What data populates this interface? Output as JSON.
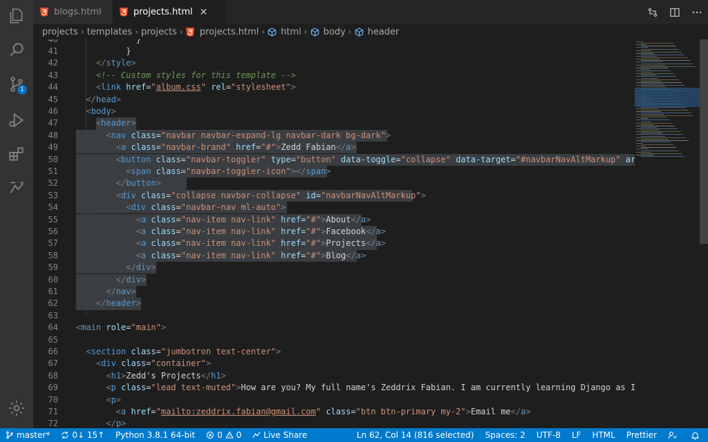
{
  "tabs": [
    {
      "label": "blogs.html"
    },
    {
      "label": "projects.html"
    }
  ],
  "breadcrumb": [
    "projects",
    "templates",
    "projects",
    "projects.html",
    "html",
    "body",
    "header"
  ],
  "editor": {
    "lines": [
      {
        "n": "40",
        "html": "            <span class=\"tx\">}</span>"
      },
      {
        "n": "41",
        "html": "          <span class=\"tx\">}</span>"
      },
      {
        "n": "42",
        "html": "    <span class=\"t\">&lt;/</span><span class=\"tn\">style</span><span class=\"t\">&gt;</span>"
      },
      {
        "n": "43",
        "html": "    <span class=\"cm\">&lt;!-- Custom styles for this template --&gt;</span>"
      },
      {
        "n": "44",
        "html": "    <span class=\"t\">&lt;</span><span class=\"tn\">link</span> <span class=\"at\">href</span><span class=\"tx\">=</span><span class=\"av\">\"<span class=\"ul\">album.css</span>\"</span> <span class=\"at\">rel</span><span class=\"tx\">=</span><span class=\"av\">\"stylesheet\"</span><span class=\"t\">&gt;</span>"
      },
      {
        "n": "45",
        "html": "  <span class=\"t\">&lt;/</span><span class=\"tn\">head</span><span class=\"t\">&gt;</span>"
      },
      {
        "n": "46",
        "html": "  <span class=\"t\">&lt;</span><span class=\"tn\">body</span><span class=\"t\">&gt;</span>"
      },
      {
        "n": "47",
        "html": "    <span class=\"t\">&lt;</span><span class=\"tn\">header</span><span class=\"t\">&gt;</span>"
      },
      {
        "n": "48",
        "html": "      <span class=\"t\">&lt;</span><span class=\"tn\">nav</span> <span class=\"at\">class</span><span class=\"tx\">=</span><span class=\"av\">\"navbar navbar-expand-lg navbar-dark bg-dark\"</span><span class=\"t\">&gt;</span>"
      },
      {
        "n": "49",
        "html": "        <span class=\"t\">&lt;</span><span class=\"tn\">a</span> <span class=\"at\">class</span><span class=\"tx\">=</span><span class=\"av\">\"navbar-brand\"</span> <span class=\"at\">href</span><span class=\"tx\">=</span><span class=\"av\">\"#\"</span><span class=\"t\">&gt;</span><span class=\"tx\">Zedd Fabian</span><span class=\"t\">&lt;/</span><span class=\"tn\">a</span><span class=\"t\">&gt;</span>"
      },
      {
        "n": "50",
        "html": "        <span class=\"t\">&lt;</span><span class=\"tn\">button</span> <span class=\"at\">class</span><span class=\"tx\">=</span><span class=\"av\">\"navbar-toggler\"</span> <span class=\"at\">type</span><span class=\"tx\">=</span><span class=\"av\">\"button\"</span> <span class=\"at\">data-toggle</span><span class=\"tx\">=</span><span class=\"av\">\"collapse\"</span> <span class=\"at\">data-target</span><span class=\"tx\">=</span><span class=\"av\">\"#navbarNavAltMarkup\"</span> <span class=\"at\">aria-c</span>"
      },
      {
        "n": "51",
        "html": "          <span class=\"t\">&lt;</span><span class=\"tn\">span</span> <span class=\"at\">class</span><span class=\"tx\">=</span><span class=\"av\">\"navbar-toggler-icon\"</span><span class=\"t\">&gt;&lt;/</span><span class=\"tn\">span</span><span class=\"t\">&gt;</span>"
      },
      {
        "n": "52",
        "html": "        <span class=\"t\">&lt;/</span><span class=\"tn\">button</span><span class=\"t\">&gt;</span>"
      },
      {
        "n": "53",
        "html": "        <span class=\"t\">&lt;</span><span class=\"tn\">div</span> <span class=\"at\">class</span><span class=\"tx\">=</span><span class=\"av\">\"collapse navbar-collapse\"</span> <span class=\"at\">id</span><span class=\"tx\">=</span><span class=\"av\">\"navbarNavAltMarkup\"</span><span class=\"t\">&gt;</span>"
      },
      {
        "n": "54",
        "html": "          <span class=\"t\">&lt;</span><span class=\"tn\">div</span> <span class=\"at\">class</span><span class=\"tx\">=</span><span class=\"av\">\"navbar-nav ml-auto\"</span><span class=\"t\">&gt;</span>"
      },
      {
        "n": "55",
        "html": "            <span class=\"t\">&lt;</span><span class=\"tn\">a</span> <span class=\"at\">class</span><span class=\"tx\">=</span><span class=\"av\">\"nav-item nav-link\"</span> <span class=\"at\">href</span><span class=\"tx\">=</span><span class=\"av\">\"#\"</span><span class=\"t\">&gt;</span><span class=\"tx\">About</span><span class=\"t\">&lt;/</span><span class=\"tn\">a</span><span class=\"t\">&gt;</span>"
      },
      {
        "n": "56",
        "html": "            <span class=\"t\">&lt;</span><span class=\"tn\">a</span> <span class=\"at\">class</span><span class=\"tx\">=</span><span class=\"av\">\"nav-item nav-link\"</span> <span class=\"at\">href</span><span class=\"tx\">=</span><span class=\"av\">\"#\"</span><span class=\"t\">&gt;</span><span class=\"tx\">Facebook</span><span class=\"t\">&lt;/</span><span class=\"tn\">a</span><span class=\"t\">&gt;</span>"
      },
      {
        "n": "57",
        "html": "            <span class=\"t\">&lt;</span><span class=\"tn\">a</span> <span class=\"at\">class</span><span class=\"tx\">=</span><span class=\"av\">\"nav-item nav-link\"</span> <span class=\"at\">href</span><span class=\"tx\">=</span><span class=\"av\">\"#\"</span><span class=\"t\">&gt;</span><span class=\"tx\">Projects</span><span class=\"t\">&lt;/</span><span class=\"tn\">a</span><span class=\"t\">&gt;</span>"
      },
      {
        "n": "58",
        "html": "            <span class=\"t\">&lt;</span><span class=\"tn\">a</span> <span class=\"at\">class</span><span class=\"tx\">=</span><span class=\"av\">\"nav-item nav-link\"</span> <span class=\"at\">href</span><span class=\"tx\">=</span><span class=\"av\">\"#\"</span><span class=\"t\">&gt;</span><span class=\"tx\">Blog</span><span class=\"t\">&lt;/</span><span class=\"tn\">a</span><span class=\"t\">&gt;</span>"
      },
      {
        "n": "59",
        "html": "          <span class=\"t\">&lt;/</span><span class=\"tn\">div</span><span class=\"t\">&gt;</span>"
      },
      {
        "n": "60",
        "html": "        <span class=\"t\">&lt;/</span><span class=\"tn\">div</span><span class=\"t\">&gt;</span>"
      },
      {
        "n": "61",
        "html": "      <span class=\"t\">&lt;/</span><span class=\"tn\">nav</span><span class=\"t\">&gt;</span>"
      },
      {
        "n": "62",
        "html": "    <span class=\"t\">&lt;/</span><span class=\"tn\">header</span><span class=\"t\">&gt;</span>"
      },
      {
        "n": "63",
        "html": ""
      },
      {
        "n": "64",
        "html": "<span class=\"t\">&lt;</span><span class=\"tn\">main</span> <span class=\"at\">role</span><span class=\"tx\">=</span><span class=\"av\">\"main\"</span><span class=\"t\">&gt;</span>"
      },
      {
        "n": "65",
        "html": ""
      },
      {
        "n": "66",
        "html": "  <span class=\"t\">&lt;</span><span class=\"tn\">section</span> <span class=\"at\">class</span><span class=\"tx\">=</span><span class=\"av\">\"jumbotron text-center\"</span><span class=\"t\">&gt;</span>"
      },
      {
        "n": "67",
        "html": "    <span class=\"t\">&lt;</span><span class=\"tn\">div</span> <span class=\"at\">class</span><span class=\"tx\">=</span><span class=\"av\">\"container\"</span><span class=\"t\">&gt;</span>"
      },
      {
        "n": "68",
        "html": "      <span class=\"t\">&lt;</span><span class=\"tn\">h1</span><span class=\"t\">&gt;</span><span class=\"tx\">Zedd's Projects</span><span class=\"t\">&lt;/</span><span class=\"tn\">h1</span><span class=\"t\">&gt;</span>"
      },
      {
        "n": "69",
        "html": "      <span class=\"t\">&lt;</span><span class=\"tn\">p</span> <span class=\"at\">class</span><span class=\"tx\">=</span><span class=\"av\">\"lead text-muted\"</span><span class=\"t\">&gt;</span><span class=\"tx\">How are you? My full name's Zeddrix Fabian. I am currently learning Django as I make</span>"
      },
      {
        "n": "70",
        "html": "      <span class=\"t\">&lt;</span><span class=\"tn\">p</span><span class=\"t\">&gt;</span>"
      },
      {
        "n": "71",
        "html": "        <span class=\"t\">&lt;</span><span class=\"tn\">a</span> <span class=\"at\">href</span><span class=\"tx\">=</span><span class=\"av\">\"<span class=\"ul\">mailto:zeddrix.fabian@gmail.com</span>\"</span> <span class=\"at\">class</span><span class=\"tx\">=</span><span class=\"av\">\"btn btn-primary my-2\"</span><span class=\"t\">&gt;</span><span class=\"tx\">Email me</span><span class=\"t\">&lt;/</span><span class=\"tn\">a</span><span class=\"t\">&gt;</span>"
      },
      {
        "n": "72",
        "html": "      <span class=\"t\">&lt;/</span><span class=\"tn\">p</span><span class=\"t\">&gt;</span>"
      }
    ]
  },
  "status": {
    "branch": "master*",
    "sync": "0↓ 15↑",
    "python": "Python 3.8.1 64-bit",
    "problems_errors": "0",
    "problems_warnings": "0",
    "live_share": "Live Share",
    "cursor": "Ln 62, Col 14 (816 selected)",
    "spaces": "Spaces: 2",
    "encoding": "UTF-8",
    "eol": "LF",
    "language": "HTML",
    "formatter": "Prettier"
  },
  "scm_badge": "1",
  "colors": {
    "status_bg": "#007acc",
    "activity_bg": "#333333",
    "editor_bg": "#1e1e1e",
    "selection": "#3a3d41"
  }
}
